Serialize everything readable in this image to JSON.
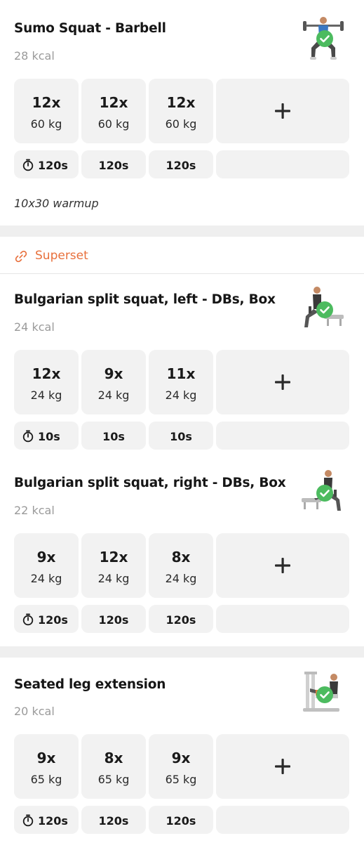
{
  "colors": {
    "accent": "#e8703c",
    "check": "#4cbb5f",
    "cell": "#f2f2f2",
    "background": "#efefef"
  },
  "exercises": [
    {
      "title": "Sumo Squat - Barbell",
      "kcal": "28 kcal",
      "completed": true,
      "sets": [
        {
          "reps": "12x",
          "weight": "60 kg"
        },
        {
          "reps": "12x",
          "weight": "60 kg"
        },
        {
          "reps": "12x",
          "weight": "60 kg"
        }
      ],
      "rests": [
        "120s",
        "120s",
        "120s"
      ],
      "note": "10x30 warmup"
    },
    {
      "title": "Bulgarian split squat, left - DBs, Box",
      "kcal": "24 kcal",
      "completed": true,
      "sets": [
        {
          "reps": "12x",
          "weight": "24 kg"
        },
        {
          "reps": "9x",
          "weight": "24 kg"
        },
        {
          "reps": "11x",
          "weight": "24 kg"
        }
      ],
      "rests": [
        "10s",
        "10s",
        "10s"
      ]
    },
    {
      "title": "Bulgarian split squat, right - DBs, Box",
      "kcal": "22 kcal",
      "completed": true,
      "sets": [
        {
          "reps": "9x",
          "weight": "24 kg"
        },
        {
          "reps": "12x",
          "weight": "24 kg"
        },
        {
          "reps": "8x",
          "weight": "24 kg"
        }
      ],
      "rests": [
        "120s",
        "120s",
        "120s"
      ]
    },
    {
      "title": "Seated leg extension",
      "kcal": "20 kcal",
      "completed": true,
      "sets": [
        {
          "reps": "9x",
          "weight": "65 kg"
        },
        {
          "reps": "8x",
          "weight": "65 kg"
        },
        {
          "reps": "9x",
          "weight": "65 kg"
        }
      ],
      "rests": [
        "120s",
        "120s",
        "120s"
      ]
    }
  ],
  "superset": {
    "label": "Superset",
    "icon": "link-icon"
  },
  "icons": {
    "add": "plus-icon",
    "rest": "stopwatch-icon",
    "done": "check-circle-icon"
  }
}
